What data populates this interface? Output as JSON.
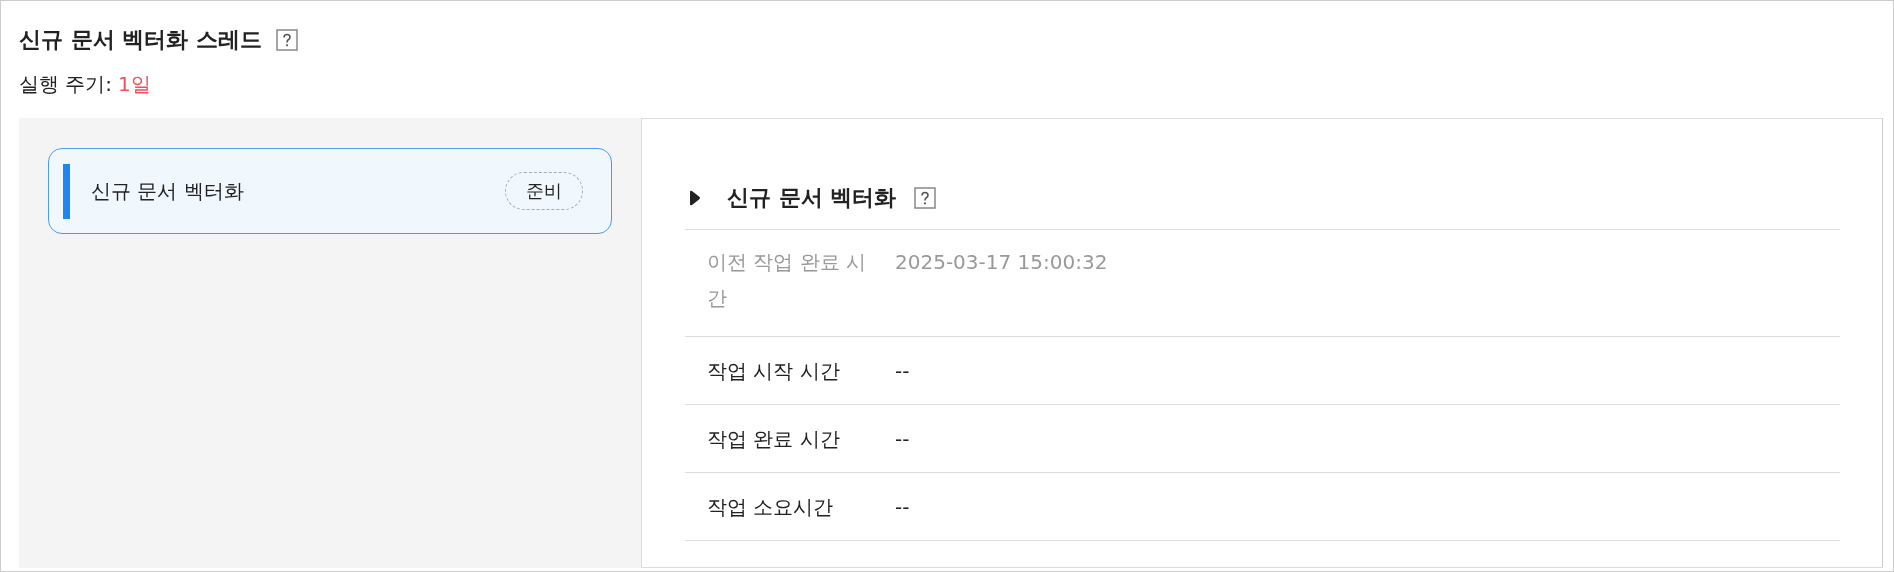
{
  "header": {
    "title": "신규 문서 벡터화 스레드",
    "cycle_label": "실행 주기:",
    "cycle_value": "1일"
  },
  "tasks": [
    {
      "name": "신규 문서 벡터화",
      "status": "준비",
      "selected": true
    }
  ],
  "detail": {
    "title": "신규 문서 벡터화",
    "rows": [
      {
        "label": "이전 작업 완료 시간",
        "value": "2025-03-17 15:00:32",
        "muted": true
      },
      {
        "label": "작업 시작 시간",
        "value": "--",
        "muted": false
      },
      {
        "label": "작업 완료 시간",
        "value": "--",
        "muted": false
      },
      {
        "label": "작업 소요시간",
        "value": "--",
        "muted": false
      }
    ]
  }
}
